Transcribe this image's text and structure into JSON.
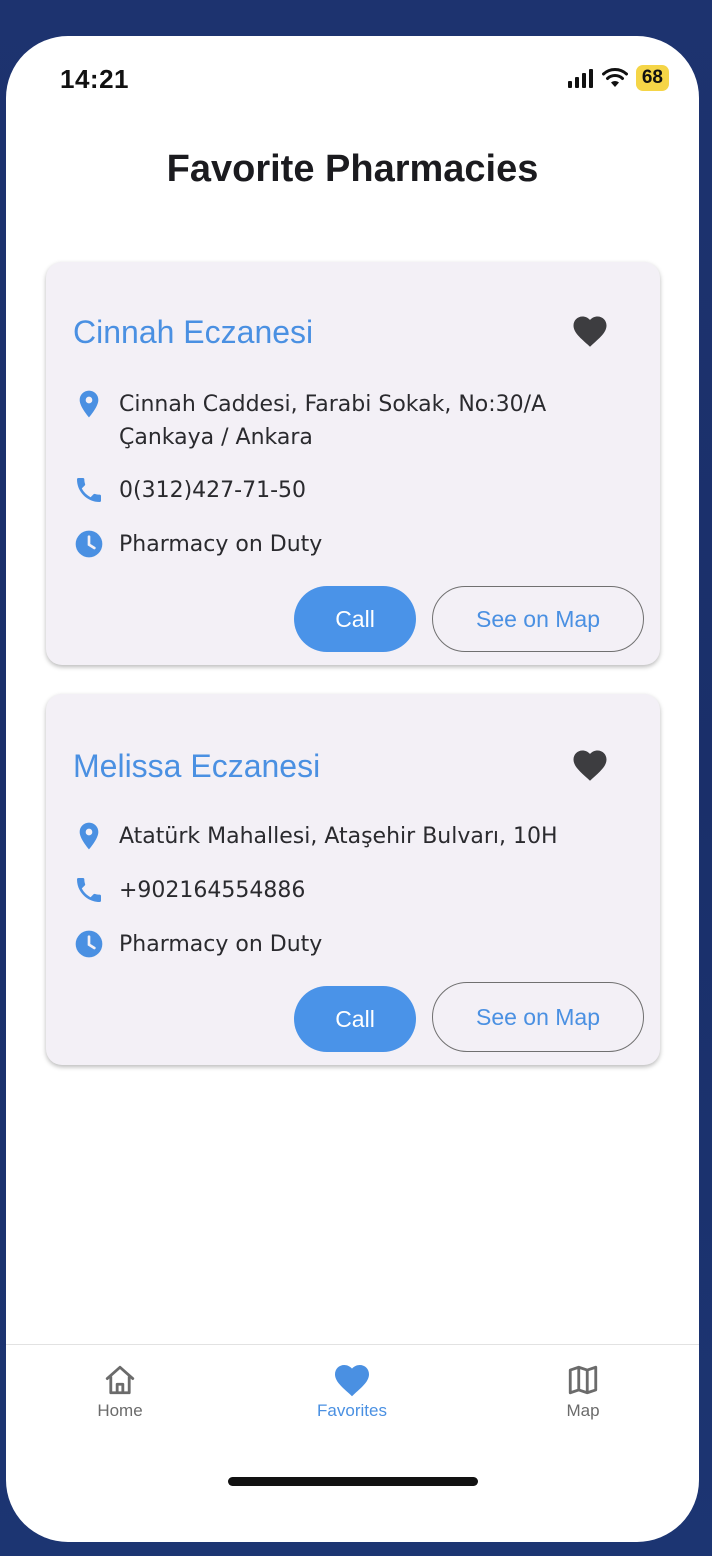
{
  "status_bar": {
    "time": "14:21",
    "battery": "68"
  },
  "page_title": "Favorite Pharmacies",
  "pharmacies": [
    {
      "name": "Cinnah Eczanesi",
      "address": "Cinnah Caddesi, Farabi Sokak, No:30/A\nÇankaya / Ankara",
      "phone": "0(312)427-71-50",
      "status": "Pharmacy on Duty",
      "call_label": "Call",
      "map_label": "See on Map"
    },
    {
      "name": "Melissa Eczanesi",
      "address": "Atatürk Mahallesi, Ataşehir Bulvarı, 10H",
      "phone": "+902164554886",
      "status": "Pharmacy on Duty",
      "call_label": "Call",
      "map_label": "See on Map"
    }
  ],
  "bottom_nav": {
    "items": [
      {
        "label": "Home",
        "icon": "home-icon",
        "active": false
      },
      {
        "label": "Favorites",
        "icon": "heart-icon",
        "active": true
      },
      {
        "label": "Map",
        "icon": "map-icon",
        "active": false
      }
    ]
  },
  "colors": {
    "accent": "#4a90e2",
    "call_button": "#4a93e8",
    "card_background": "#f3f0f6",
    "heart_icon": "#3d3d40",
    "battery_badge": "#f5d547"
  }
}
